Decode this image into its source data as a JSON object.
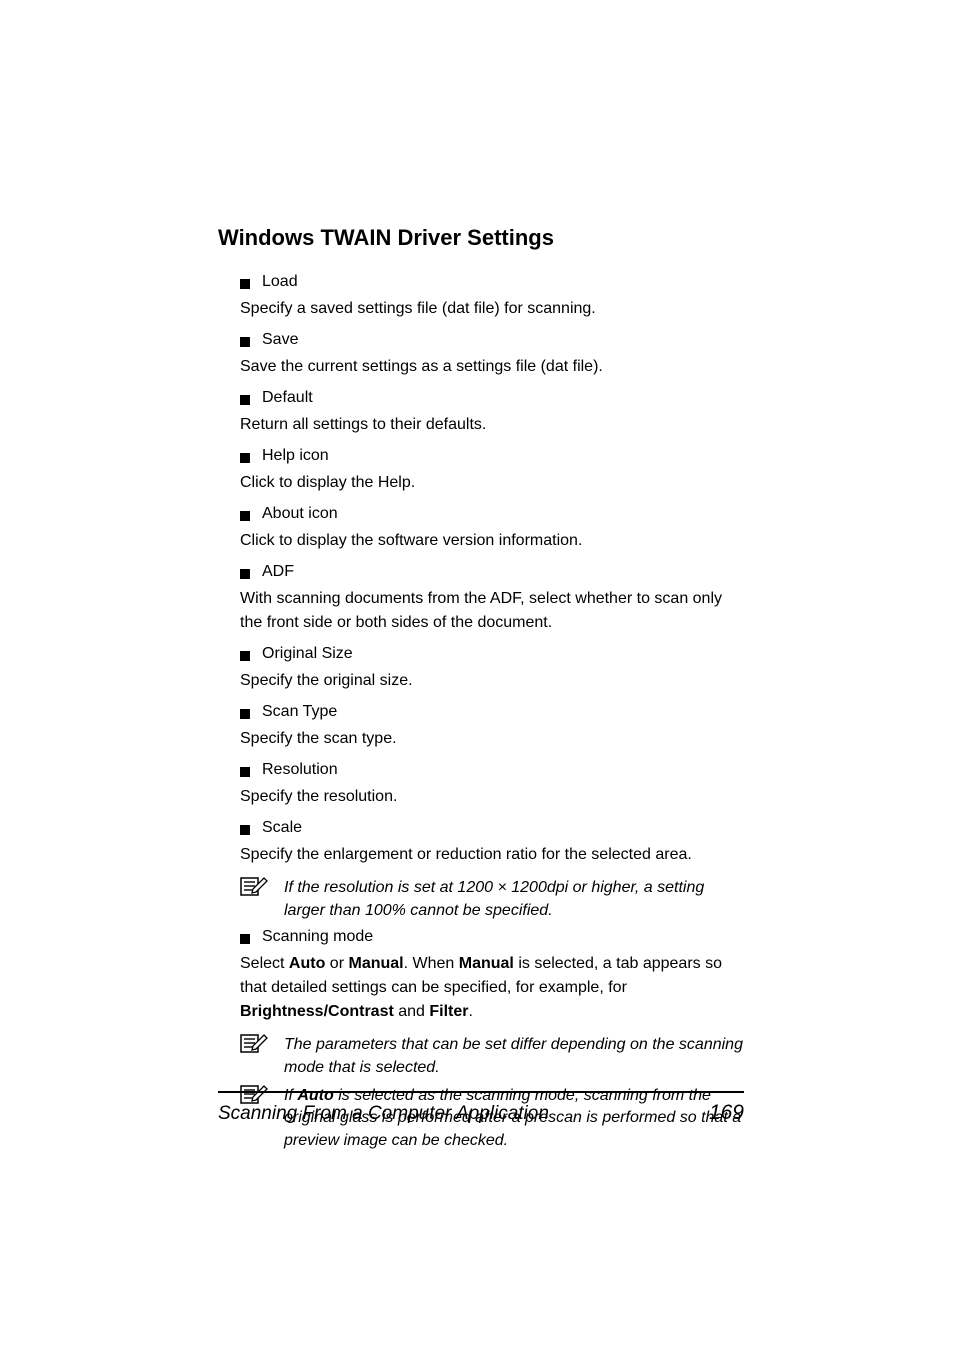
{
  "section_title": "Windows TWAIN Driver Settings",
  "items": [
    {
      "label": "Load",
      "desc": "Specify a saved settings file (dat file) for scanning."
    },
    {
      "label": "Save",
      "desc": "Save the current settings as a settings file (dat file)."
    },
    {
      "label": "Default",
      "desc": "Return all settings to their defaults."
    },
    {
      "label": "Help icon",
      "desc": "Click to display the Help."
    },
    {
      "label": "About icon",
      "desc": "Click to display the software version information."
    },
    {
      "label": "ADF",
      "desc": "With scanning documents from the ADF, select whether to scan only the front side or both sides of the document."
    },
    {
      "label": "Original Size",
      "desc": "Specify the original size."
    },
    {
      "label": "Scan Type",
      "desc": "Specify the scan type."
    },
    {
      "label": "Resolution",
      "desc": "Specify the resolution."
    },
    {
      "label": "Scale",
      "desc": "Specify the enlargement or reduction ratio for the selected area."
    }
  ],
  "note1": "If the resolution is set at 1200 × 1200dpi or higher, a setting larger than 100% cannot be specified.",
  "scanning_mode": {
    "label": "Scanning mode",
    "pre": "Select ",
    "auto": "Auto",
    "or": " or ",
    "manual": "Manual",
    "mid1": ". When ",
    "manual2": "Manual",
    "mid2": " is selected, a tab appears so that detailed settings can be specified, for example, for ",
    "bc": "Brightness/Contrast",
    "and": " and ",
    "filter": "Filter",
    "tail": "."
  },
  "note2": "The parameters that can be set differ depending on the scanning mode that is selected.",
  "note3_pre": "If ",
  "note3_bold": "Auto",
  "note3_post": " is selected as the scanning mode, scanning from the original glass is performed after a prescan is performed so that a preview image can be checked.",
  "footer": {
    "title": "Scanning From a Computer Application",
    "page": "169"
  }
}
